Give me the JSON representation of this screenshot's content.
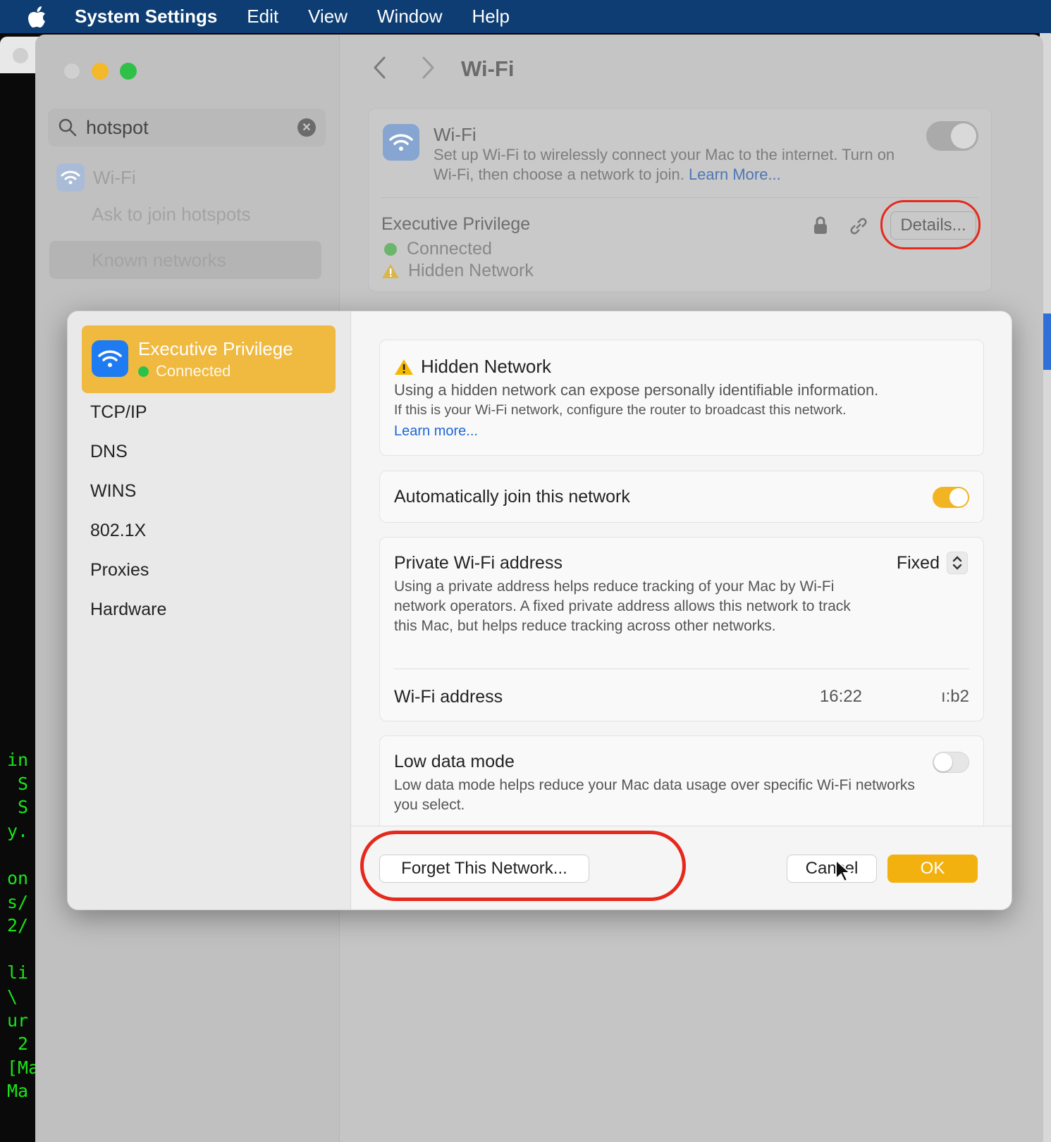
{
  "menubar": {
    "app_name": "System Settings",
    "items": [
      "Edit",
      "View",
      "Window",
      "Help"
    ]
  },
  "terminal": {
    "lines": [
      "in",
      " S",
      " S",
      "y.",
      "",
      "on",
      "s/",
      "2/",
      "",
      "li",
      "\\ ",
      "ur",
      " 2",
      "[Ma",
      "Ma"
    ]
  },
  "sidebar": {
    "search_value": "hotspot",
    "wifi_label": "Wi-Fi",
    "sub_items": [
      "Ask to join hotspots",
      "Known networks"
    ],
    "selected": "Known networks"
  },
  "pane": {
    "title": "Wi-Fi",
    "wifi_card": {
      "title": "Wi-Fi",
      "description": "Set up Wi-Fi to wirelessly connect your Mac to the internet. Turn on Wi-Fi, then choose a network to join. ",
      "learn_more": "Learn More...",
      "enabled": false
    },
    "network": {
      "name": "Executive Privilege",
      "status": "Connected",
      "warning": "Hidden Network",
      "details_button": "Details..."
    }
  },
  "sheet": {
    "network_name": "Executive Privilege",
    "network_status": "Connected",
    "side_items": [
      "TCP/IP",
      "DNS",
      "WINS",
      "802.1X",
      "Proxies",
      "Hardware"
    ],
    "hidden": {
      "title": "Hidden Network",
      "desc1": "Using a hidden network can expose personally identifiable information.",
      "desc2": "If this is your Wi-Fi network, configure the router to broadcast this network.",
      "learn": "Learn more..."
    },
    "auto_join": {
      "label": "Automatically join this network",
      "enabled": true
    },
    "private": {
      "label": "Private Wi-Fi address",
      "value": "Fixed",
      "desc": "Using a private address helps reduce tracking of your Mac by Wi-Fi network operators. A fixed private address allows this network to track this Mac, but helps reduce tracking across other networks.",
      "address_label": "Wi-Fi address",
      "address_start": "16:22",
      "address_end": "ı:b2"
    },
    "low_data": {
      "label": "Low data mode",
      "desc": "Low data mode helps reduce your Mac data usage over specific Wi-Fi networks you select.",
      "enabled": false
    },
    "buttons": {
      "forget": "Forget This Network...",
      "cancel": "Cancel",
      "ok": "OK"
    }
  },
  "colors": {
    "menubar": "#0d3d73",
    "accent": "#f2b10f",
    "annotation": "#e5291c",
    "link": "#1d66d6"
  }
}
